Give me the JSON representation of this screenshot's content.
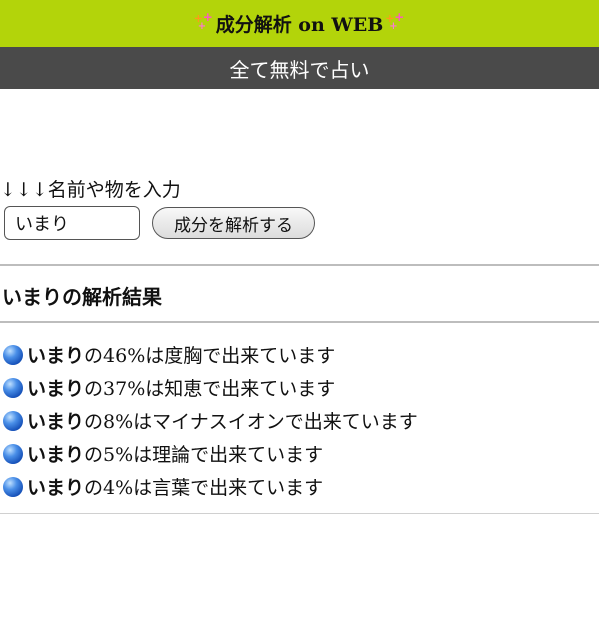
{
  "header": {
    "title": "成分解析 on WEB",
    "subtitle": "全て無料で占い"
  },
  "form": {
    "label": "↓↓↓名前や物を入力",
    "input_value": "いまり",
    "button_label": "成分を解析する"
  },
  "result": {
    "title": "いまりの解析結果",
    "items": [
      {
        "name": "いまり",
        "text": "の46%は度胸で出来ています"
      },
      {
        "name": "いまり",
        "text": "の37%は知恵で出来ています"
      },
      {
        "name": "いまり",
        "text": "の8%はマイナスイオンで出来ています"
      },
      {
        "name": "いまり",
        "text": "の5%は理論で出来ています"
      },
      {
        "name": "いまり",
        "text": "の4%は言葉で出来ています"
      }
    ]
  },
  "colors": {
    "header_bg": "#b3d40a",
    "subheader_bg": "#4a4a4a",
    "sparkle": "#ff55c8",
    "bullet": "#1e5fd0"
  }
}
